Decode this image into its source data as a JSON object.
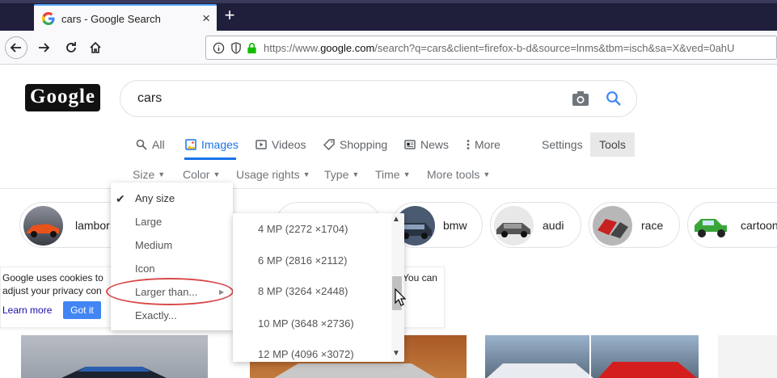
{
  "browser": {
    "tab_title": "cars - Google Search",
    "tab_close": "×",
    "new_tab": "+",
    "url_prefix": "https://www.",
    "url_domain": "google.com",
    "url_rest": "/search?q=cars&client=firefox-b-d&source=lnms&tbm=isch&sa=X&ved=0ahU"
  },
  "logo_text": "Google",
  "search": {
    "query": "cars"
  },
  "tabs": [
    {
      "label": "All",
      "icon": "search-icon"
    },
    {
      "label": "Images",
      "icon": "image-icon",
      "active": true
    },
    {
      "label": "Videos",
      "icon": "play-icon"
    },
    {
      "label": "Shopping",
      "icon": "tag-icon"
    },
    {
      "label": "News",
      "icon": "news-icon"
    },
    {
      "label": "More",
      "icon": "more-vert-icon"
    }
  ],
  "settings_label": "Settings",
  "tools_label": "Tools",
  "filters": [
    "Size",
    "Color",
    "Usage rights",
    "Type",
    "Time",
    "More tools"
  ],
  "chips": [
    "lambor",
    "bmw",
    "audi",
    "race",
    "cartoon"
  ],
  "cookie": {
    "line1": "Google uses cookies to",
    "line2": "adjust your privacy con",
    "line3": "You can",
    "learn_more": "Learn more",
    "got_it": "Got it"
  },
  "size_menu": {
    "items": [
      "Any size",
      "Large",
      "Medium",
      "Icon",
      "Larger than...",
      "Exactly..."
    ],
    "checked": "Any size"
  },
  "larger_than_options": [
    "4 MP (2272 ×1704)",
    "6 MP (2816 ×2112)",
    "8 MP (3264 ×2448)",
    "10 MP (3648 ×2736)",
    "12 MP (4096 ×3072)"
  ],
  "colors": {
    "accent": "#1a73e8",
    "highlight": "#d94848",
    "got_it_bg": "#4285f4"
  }
}
